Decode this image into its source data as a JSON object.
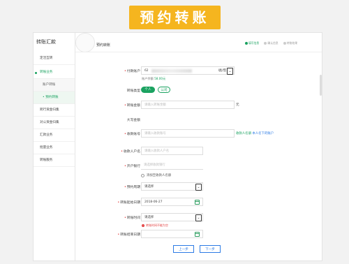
{
  "banner": {
    "text": "预约转账"
  },
  "sidebar": {
    "title": "转账汇款",
    "items": [
      {
        "label": "定活互转"
      },
      {
        "label": "转账业务"
      },
      {
        "label": "账户转账"
      },
      {
        "label": "• 预约转账"
      },
      {
        "label": "跨行资金归集"
      },
      {
        "label": "对公资金归集"
      },
      {
        "label": "汇款业务"
      },
      {
        "label": "批量业务"
      },
      {
        "label": "转账服务"
      }
    ]
  },
  "main": {
    "title": "预约转账"
  },
  "steps": [
    "填写信息",
    "确认信息",
    "转账结果"
  ],
  "form": {
    "account": {
      "label": "付款账户",
      "prefix": "62",
      "type": "I类/借"
    },
    "balance_note": "账户余额",
    "balance_value": "58.00元",
    "transfer_type": {
      "label": "转账类型",
      "options": [
        "个人",
        "公司"
      ]
    },
    "amount": {
      "label": "转账金额",
      "placeholder": "请输入转账金额",
      "unit": "元"
    },
    "capital": {
      "label": "大写金额"
    },
    "payee_account": {
      "label": "收款账号",
      "placeholder": "请输入收款账号",
      "link": "收款人名册",
      "link2": "本人名下的账户"
    },
    "payee_name": {
      "label": "收款人户名",
      "placeholder": "请输入收款人户名"
    },
    "bank": {
      "label": "开户银行",
      "placeholder": "请选择收款银行"
    },
    "add_payee": "添加至收款人名册",
    "cycle": {
      "label": "预约周期",
      "value": "请选择"
    },
    "start_date": {
      "label": "转账起始日期",
      "value": "2018-06-27"
    },
    "time": {
      "label": "转账时间",
      "value": "请选择",
      "warning": "转账时间不能为空"
    },
    "end_date": {
      "label": "转账结束日期"
    }
  },
  "buttons": {
    "prev": "上一步",
    "next": "下一步"
  },
  "colors": {
    "accent": "#1aa260",
    "banner": "#f5b51f",
    "link": "#2c7be5",
    "error": "#e23b3b"
  }
}
